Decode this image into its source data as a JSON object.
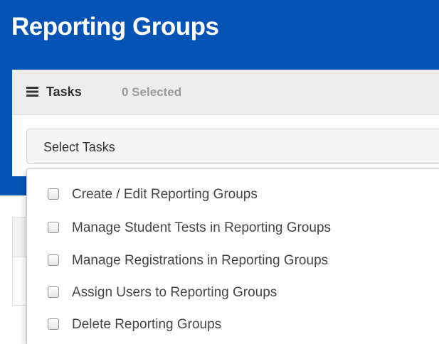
{
  "page": {
    "title": "Reporting Groups"
  },
  "tasks": {
    "label": "Tasks",
    "selected_count": "0 Selected",
    "select_placeholder": "Select Tasks"
  },
  "task_options": [
    {
      "label": "Create / Edit Reporting Groups",
      "checked": false
    },
    {
      "label": "Manage Student Tests in Reporting Groups",
      "checked": false
    },
    {
      "label": "Manage Registrations in Reporting Groups",
      "checked": false
    },
    {
      "label": "Assign Users to Reporting Groups",
      "checked": false
    },
    {
      "label": "Delete Reporting Groups",
      "checked": false
    }
  ],
  "colors": {
    "header_blue": "#0554b5",
    "tasks_bar": "#ececec",
    "count_gray": "#9a9a9a"
  },
  "icons": {
    "tasks": "list-icon",
    "option": "checkbox-icon"
  }
}
